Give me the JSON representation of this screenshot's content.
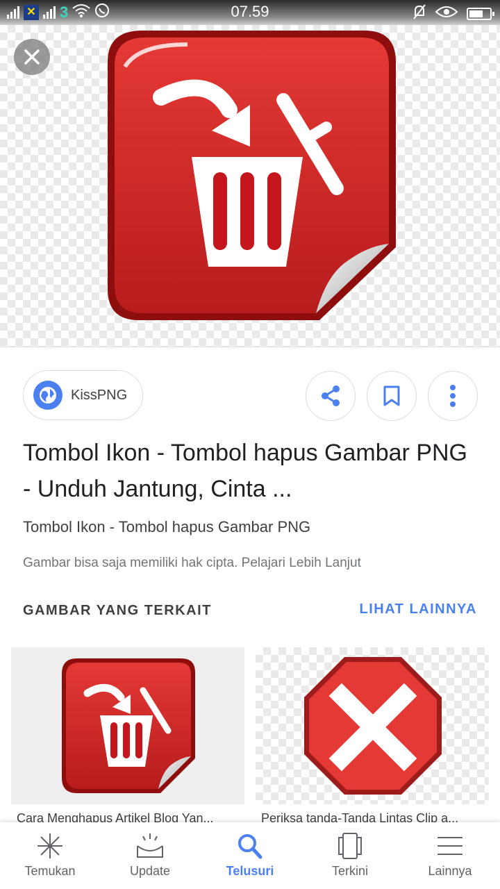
{
  "status_bar": {
    "time": "07.59",
    "carrier_glyph": "3"
  },
  "source": {
    "label": "KissPNG"
  },
  "result": {
    "title": "Tombol Ikon - Tombol hapus Gambar PNG - Unduh Jantung, Cinta ...",
    "subtitle": "Tombol Ikon - Tombol hapus Gambar PNG",
    "copyright_notice": "Gambar bisa saja memiliki hak cipta. Pelajari Lebih Lanjut"
  },
  "related": {
    "heading": "GAMBAR YANG TERKAIT",
    "see_more": "LIHAT LAINNYA",
    "items": [
      {
        "caption": "Cara Menghapus Artikel Blog Yan..."
      },
      {
        "caption": "Periksa tanda-Tanda Lintas Clip a..."
      }
    ]
  },
  "bottom_nav": {
    "items": [
      {
        "label": "Temukan",
        "icon": "sparkle-icon"
      },
      {
        "label": "Update",
        "icon": "inbox-icon"
      },
      {
        "label": "Telusuri",
        "icon": "search-icon"
      },
      {
        "label": "Terkini",
        "icon": "cards-icon"
      },
      {
        "label": "Lainnya",
        "icon": "menu-icon"
      }
    ],
    "active": "Telusuri"
  },
  "colors": {
    "accent": "#4a80f0",
    "icon_red": "#c4161c",
    "stop_red": "#d32f2f"
  }
}
